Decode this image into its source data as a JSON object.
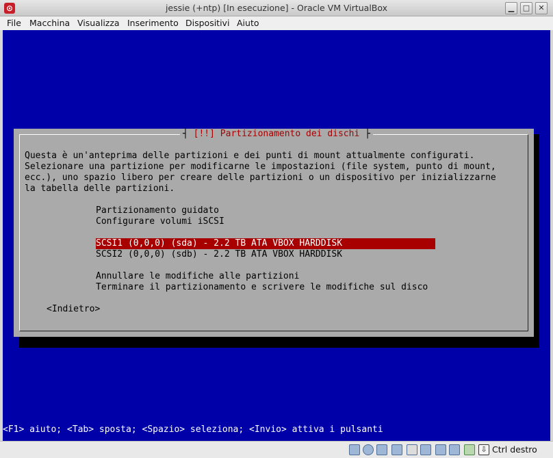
{
  "window": {
    "title": "jessie (+ntp) [In esecuzione] - Oracle VM VirtualBox",
    "app_icon": "virtualbox-icon",
    "controls": [
      "minimize-icon",
      "maximize-icon",
      "close-icon"
    ]
  },
  "menubar": {
    "items": [
      {
        "label": "File"
      },
      {
        "label": "Macchina"
      },
      {
        "label": "Visualizza"
      },
      {
        "label": "Inserimento"
      },
      {
        "label": "Dispositivi"
      },
      {
        "label": "Aiuto"
      }
    ]
  },
  "installer": {
    "dialog_title": "[!!] Partizionamento dei dischi",
    "description": [
      "Questa è un'anteprima delle partizioni e dei punti di mount attualmente configurati.",
      "Selezionare una partizione per modificarne le impostazioni (file system, punto di mount,",
      "ecc.), uno spazio libero per creare delle partizioni o un dispositivo per inizializzarne",
      "la tabella delle partizioni."
    ],
    "options": [
      "Partizionamento guidato",
      "Configurare volumi iSCSI",
      "SCSI1 (0,0,0) (sda) - 2.2 TB ATA VBOX HARDDISK",
      "SCSI2 (0,0,0) (sdb) - 2.2 TB ATA VBOX HARDDISK",
      "Annullare le modifiche alle partizioni",
      "Terminare il partizionamento e scrivere le modifiche sul disco"
    ],
    "selected_index": 2,
    "back_button": "<Indietro>",
    "help_line": "<F1> aiuto; <Tab> sposta; <Spazio> seleziona; <Invio> attiva i pulsanti",
    "colors": {
      "screen_bg": "#0000a8",
      "dialog_bg": "#aaaaaa",
      "title_fg": "#a80000",
      "selection_bg": "#a80000"
    }
  },
  "statusbar": {
    "icons": [
      "hard-disk-icon",
      "optical-drive-icon",
      "usb-icon",
      "edit-icon",
      "floppy-icon",
      "display-icon",
      "network-icon",
      "usb-device-icon",
      "shared-folder-icon",
      "capture-icon"
    ],
    "host_key": "Ctrl destro"
  }
}
